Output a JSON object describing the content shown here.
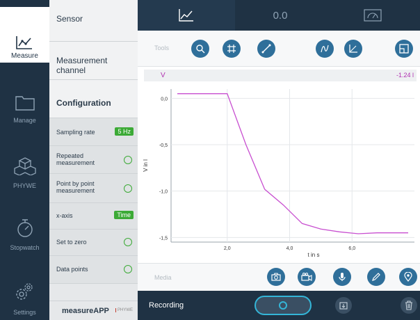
{
  "nav": {
    "items": [
      {
        "label": "Measure",
        "icon": "line-chart-icon",
        "active": true
      },
      {
        "label": "Manage",
        "icon": "folder-icon",
        "active": false
      },
      {
        "label": "PHYWE",
        "icon": "cubes-icon",
        "active": false
      },
      {
        "label": "Stopwatch",
        "icon": "stopwatch-icon",
        "active": false
      },
      {
        "label": "Settings",
        "icon": "gear-icon",
        "active": false
      }
    ]
  },
  "panel": {
    "sensor": "Sensor",
    "measurement_channel": "Measurement channel",
    "configuration": "Configuration",
    "sampling_rate_label": "Sampling rate",
    "sampling_rate_value": "5 Hz",
    "repeated_measurement": "Repeated measurement",
    "point_by_point": "Point by point measurement",
    "x_axis_label": "x-axis",
    "x_axis_value": "Time",
    "set_to_zero": "Set to zero",
    "data_points": "Data points",
    "logo_text": "measureAPP",
    "logo_brand": "PHYWE"
  },
  "tabs": {
    "graph_icon": "graph-icon",
    "value_label": "0.0",
    "gauge_icon": "gauge-icon"
  },
  "tools": {
    "label": "Tools",
    "buttons": [
      "zoom-icon",
      "crosshair-icon",
      "line-tool-icon",
      "fit-curve-icon",
      "axes-icon",
      "layout-icon"
    ]
  },
  "channel": {
    "name": "V",
    "value": "-1.24 l"
  },
  "chart_data": {
    "type": "line",
    "xlabel": "t in s",
    "ylabel": "V in l",
    "xlim": [
      0.2,
      8.0
    ],
    "ylim": [
      -1.55,
      0.1
    ],
    "x_ticks": [
      2.0,
      4.0,
      6.0
    ],
    "x_tick_labels": [
      "2,0",
      "4,0",
      "6,0"
    ],
    "y_ticks": [
      0.0,
      -0.5,
      -1.0,
      -1.5
    ],
    "y_tick_labels": [
      "0,0",
      "-0,5",
      "-1,0",
      "-1,5"
    ],
    "series": [
      {
        "color": "#c84fd0",
        "x": [
          0.4,
          1.4,
          2.0,
          2.6,
          3.2,
          3.8,
          4.4,
          5.0,
          5.6,
          6.2,
          6.8,
          7.4,
          7.8
        ],
        "y": [
          0.05,
          0.05,
          0.05,
          -0.5,
          -0.98,
          -1.15,
          -1.35,
          -1.41,
          -1.44,
          -1.46,
          -1.45,
          -1.45,
          -1.45
        ]
      }
    ],
    "grid": true
  },
  "media": {
    "label": "Media",
    "buttons": [
      "camera-icon",
      "video-icon",
      "microphone-icon",
      "pencil-icon",
      "location-icon"
    ]
  },
  "recording": {
    "label": "Recording",
    "save_icon": "save-icon",
    "trash_icon": "trash-icon"
  }
}
